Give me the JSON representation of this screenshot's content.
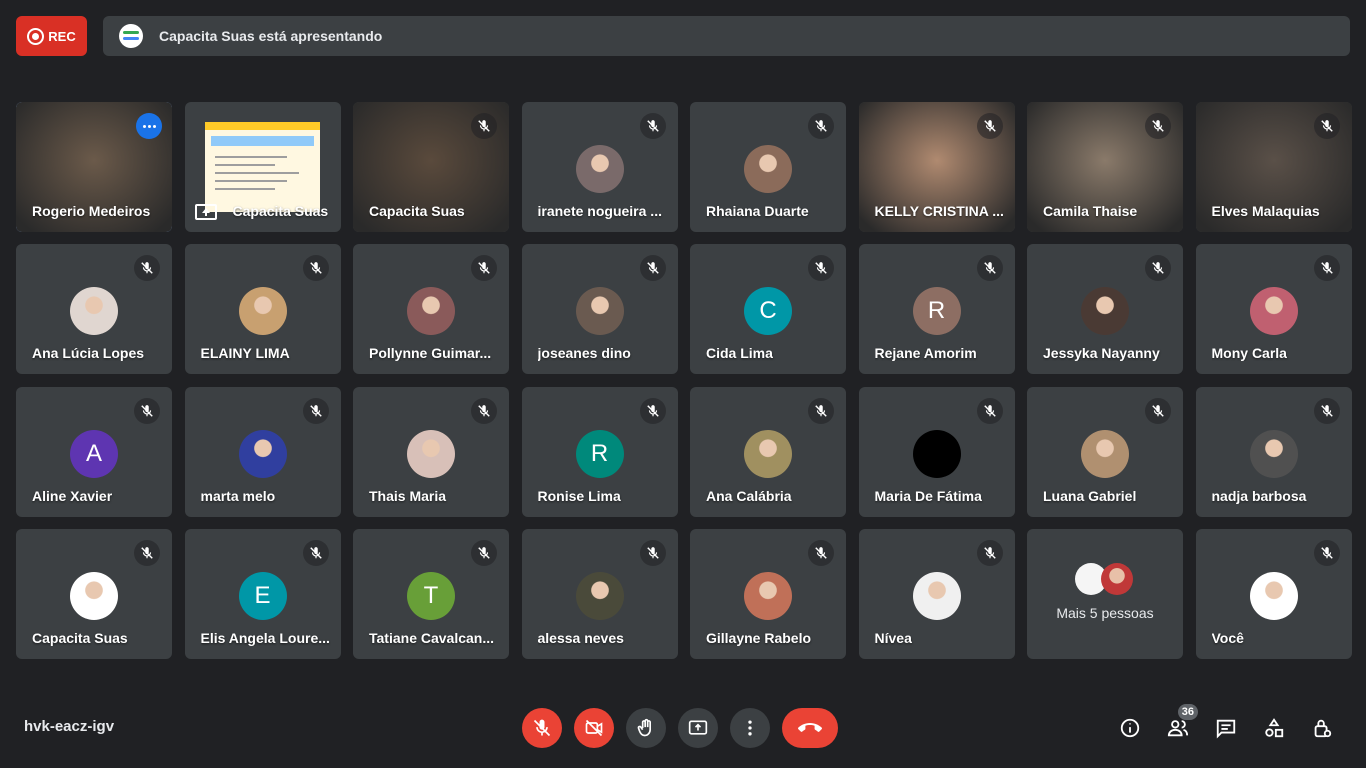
{
  "recording": {
    "label": "REC"
  },
  "presenting_banner": {
    "text": "Capacita Suas está apresentando"
  },
  "tiles": [
    {
      "name": "Rogerio Medeiros",
      "kind": "video",
      "active": true,
      "bg": "#6b5a4a"
    },
    {
      "name": "Capacita Suas",
      "kind": "screen"
    },
    {
      "name": "Capacita Suas",
      "kind": "video",
      "bg": "#5a4a3c"
    },
    {
      "name": "iranete nogueira ...",
      "kind": "avatar",
      "avatar_color": "#7a6a6a"
    },
    {
      "name": "Rhaiana Duarte",
      "kind": "avatar",
      "avatar_color": "#8b6b5a"
    },
    {
      "name": "KELLY CRISTINA ...",
      "kind": "video",
      "bg": "#b08a70"
    },
    {
      "name": "Camila Thaise",
      "kind": "video",
      "bg": "#8a7a6a"
    },
    {
      "name": "Elves Malaquias",
      "kind": "video",
      "bg": "#5a5048"
    },
    {
      "name": "Ana Lúcia Lopes",
      "kind": "avatar",
      "avatar_color": "#e0d6d0"
    },
    {
      "name": "ELAINY LIMA",
      "kind": "avatar",
      "avatar_color": "#c8a070"
    },
    {
      "name": "Pollynne Guimar...",
      "kind": "avatar",
      "avatar_color": "#8a5a5a"
    },
    {
      "name": "joseanes dino",
      "kind": "avatar",
      "avatar_color": "#6a5a50"
    },
    {
      "name": "Cida Lima",
      "kind": "letter",
      "letter": "C",
      "avatar_color": "#0097a7"
    },
    {
      "name": "Rejane Amorim",
      "kind": "letter",
      "letter": "R",
      "avatar_color": "#8d6e63"
    },
    {
      "name": "Jessyka Nayanny",
      "kind": "avatar",
      "avatar_color": "#4a3a34"
    },
    {
      "name": "Mony Carla",
      "kind": "avatar",
      "avatar_color": "#c06070"
    },
    {
      "name": "Aline Xavier",
      "kind": "letter",
      "letter": "A",
      "avatar_color": "#5e35b1"
    },
    {
      "name": "marta melo",
      "kind": "avatar",
      "avatar_color": "#303f9f"
    },
    {
      "name": "Thais Maria",
      "kind": "avatar",
      "avatar_color": "#d8c0b8"
    },
    {
      "name": "Ronise Lima",
      "kind": "letter",
      "letter": "R",
      "avatar_color": "#00897b"
    },
    {
      "name": "Ana Calábria",
      "kind": "avatar",
      "avatar_color": "#a09060"
    },
    {
      "name": "Maria De Fátima",
      "kind": "avatar",
      "avatar_color": "#000000"
    },
    {
      "name": "Luana Gabriel",
      "kind": "avatar",
      "avatar_color": "#b09070"
    },
    {
      "name": "nadja barbosa",
      "kind": "avatar",
      "avatar_color": "#505050"
    },
    {
      "name": "Capacita Suas",
      "kind": "avatar",
      "avatar_color": "#ffffff"
    },
    {
      "name": "Elis Angela Loure...",
      "kind": "letter",
      "letter": "E",
      "avatar_color": "#0097a7"
    },
    {
      "name": "Tatiane Cavalcan...",
      "kind": "letter",
      "letter": "T",
      "avatar_color": "#689f38"
    },
    {
      "name": "alessa neves",
      "kind": "avatar",
      "avatar_color": "#4a4a3a"
    },
    {
      "name": "Gillayne Rabelo",
      "kind": "avatar",
      "avatar_color": "#c07058"
    },
    {
      "name": "Nívea",
      "kind": "avatar",
      "avatar_color": "#f0f0f0"
    },
    {
      "name": "Mais 5 pessoas",
      "kind": "more"
    },
    {
      "name": "Você",
      "kind": "avatar",
      "avatar_color": "#ffffff"
    }
  ],
  "bottom": {
    "meeting_code": "hvk-eacz-igv",
    "controls": [
      "mic-off-icon",
      "camera-off-icon",
      "raise-hand-icon",
      "present-screen-icon",
      "more-options-icon",
      "end-call-icon"
    ],
    "right_icons": [
      "info-icon",
      "people-icon",
      "chat-icon",
      "activities-icon",
      "host-controls-icon"
    ],
    "participant_count": "36"
  }
}
